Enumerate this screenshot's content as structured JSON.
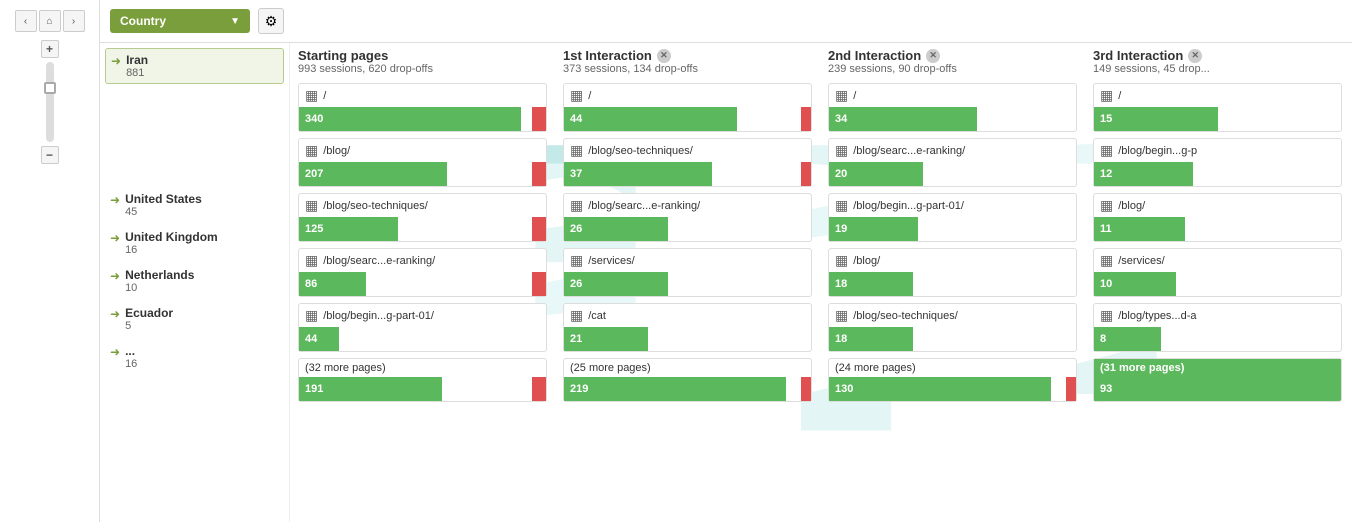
{
  "filter": {
    "country_label": "Country",
    "country_dropdown_text": "Country"
  },
  "nav": {
    "back": "‹",
    "home": "⌂",
    "forward": "›",
    "zoom_in": "+",
    "zoom_out": "−"
  },
  "countries": [
    {
      "name": "Iran",
      "count": "881",
      "active": true
    },
    {
      "name": "United States",
      "count": "45",
      "active": false
    },
    {
      "name": "United Kingdom",
      "count": "16",
      "active": false
    },
    {
      "name": "Netherlands",
      "count": "10",
      "active": false
    },
    {
      "name": "Ecuador",
      "count": "5",
      "active": false
    },
    {
      "name": "...",
      "count": "16",
      "active": false
    }
  ],
  "columns": [
    {
      "id": "starting",
      "title": "Starting pages",
      "subtitle": "993 sessions, 620 drop-offs",
      "has_close": false,
      "nodes": [
        {
          "name": "/",
          "count": 340,
          "bar_pct": 90,
          "dropoff": true
        },
        {
          "name": "/blog/",
          "count": 207,
          "bar_pct": 60,
          "dropoff": true
        },
        {
          "name": "/blog/seo-techniques/",
          "count": 125,
          "bar_pct": 38,
          "dropoff": true
        },
        {
          "name": "/blog/searc...e-ranking/",
          "count": 86,
          "bar_pct": 26,
          "dropoff": true
        },
        {
          "name": "/blog/begin...g-part-01/",
          "count": 44,
          "bar_pct": 14,
          "dropoff": false
        },
        {
          "name": "(32 more pages)",
          "count": 191,
          "bar_pct": 58,
          "dropoff": true
        }
      ]
    },
    {
      "id": "interaction1",
      "title": "1st Interaction",
      "subtitle": "373 sessions, 134 drop-offs",
      "has_close": true,
      "nodes": [
        {
          "name": "/",
          "count": 44,
          "bar_pct": 70,
          "dropoff": true
        },
        {
          "name": "/blog/seo-techniques/",
          "count": 37,
          "bar_pct": 60,
          "dropoff": true
        },
        {
          "name": "/blog/searc...e-ranking/",
          "count": 26,
          "bar_pct": 42,
          "dropoff": false
        },
        {
          "name": "/services/",
          "count": 26,
          "bar_pct": 42,
          "dropoff": false
        },
        {
          "name": "/cat",
          "count": 21,
          "bar_pct": 34,
          "dropoff": false
        },
        {
          "name": "(25 more pages)",
          "count": 219,
          "bar_pct": 90,
          "dropoff": true
        }
      ]
    },
    {
      "id": "interaction2",
      "title": "2nd Interaction",
      "subtitle": "239 sessions, 90 drop-offs",
      "has_close": true,
      "nodes": [
        {
          "name": "/",
          "count": 34,
          "bar_pct": 60,
          "dropoff": false
        },
        {
          "name": "/blog/searc...e-ranking/",
          "count": 20,
          "bar_pct": 36,
          "dropoff": false
        },
        {
          "name": "/blog/begin...g-part-01/",
          "count": 19,
          "bar_pct": 34,
          "dropoff": false
        },
        {
          "name": "/blog/",
          "count": 18,
          "bar_pct": 32,
          "dropoff": false
        },
        {
          "name": "/blog/seo-techniques/",
          "count": 18,
          "bar_pct": 32,
          "dropoff": false
        },
        {
          "name": "(24 more pages)",
          "count": 130,
          "bar_pct": 90,
          "dropoff": true
        }
      ]
    },
    {
      "id": "interaction3",
      "title": "3rd Interaction",
      "subtitle": "149 sessions, 45 drop...",
      "has_close": true,
      "nodes": [
        {
          "name": "/",
          "count": 15,
          "bar_pct": 50,
          "dropoff": false
        },
        {
          "name": "/blog/begin...g-p",
          "count": 12,
          "bar_pct": 40,
          "dropoff": false
        },
        {
          "name": "/blog/",
          "count": 11,
          "bar_pct": 36,
          "dropoff": false
        },
        {
          "name": "/services/",
          "count": 10,
          "bar_pct": 33,
          "dropoff": false
        },
        {
          "name": "/blog/types...d-a",
          "count": 8,
          "bar_pct": 27,
          "dropoff": false
        },
        {
          "name": "(31 more pages)",
          "count": 93,
          "bar_pct": 90,
          "dropoff": false
        }
      ]
    }
  ]
}
